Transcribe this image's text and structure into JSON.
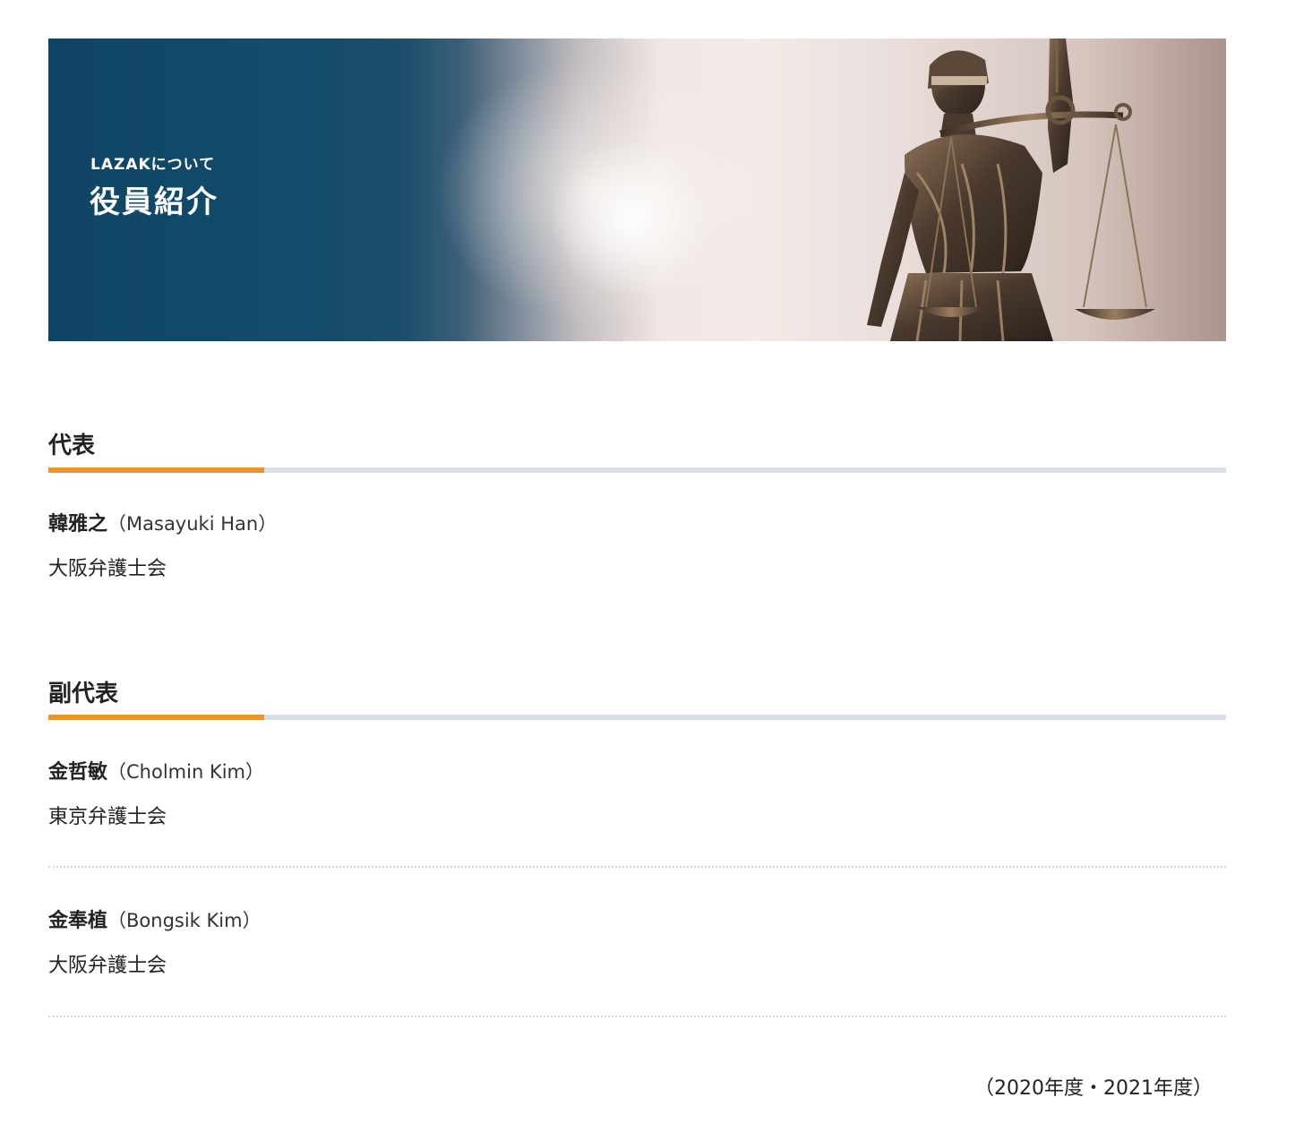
{
  "hero": {
    "kicker": "LAZAKについて",
    "title": "役員紹介",
    "image_icon": "lady-justice-statue-icon"
  },
  "sections": [
    {
      "heading": "代表",
      "members": [
        {
          "name_jp": "韓雅之",
          "name_en": "（Masayuki Han）",
          "bar": "大阪弁護士会"
        }
      ]
    },
    {
      "heading": "副代表",
      "members": [
        {
          "name_jp": "金哲敏",
          "name_en": "（Cholmin Kim）",
          "bar": "東京弁護士会"
        },
        {
          "name_jp": "金奉植",
          "name_en": "（Bongsik Kim）",
          "bar": "大阪弁護士会"
        }
      ]
    }
  ],
  "fiscal_note": "（2020年度・2021年度）",
  "colors": {
    "banner_blue": "#0f4464",
    "accent_orange": "#f39321",
    "rule_gray": "#d9dfe8"
  }
}
